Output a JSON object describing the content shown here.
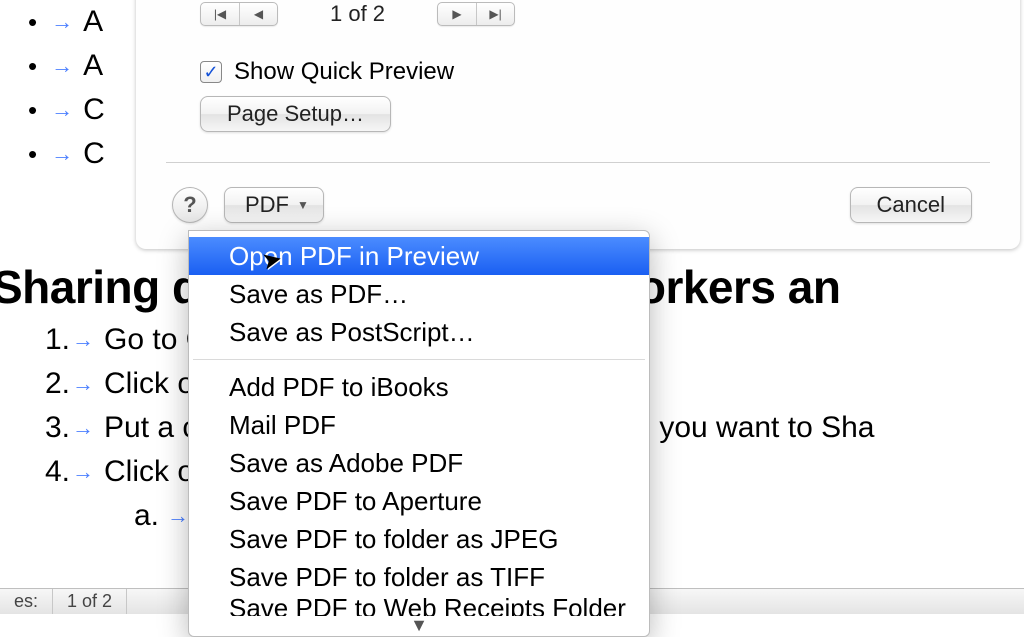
{
  "doc": {
    "bullet_items": [
      "A",
      "A",
      "C",
      "C"
    ],
    "heading": "Sharing documents with Co-workers an",
    "numbered": [
      "Go to Onedrive.live.com and sign in",
      "Click on Documents",
      "Put a check in the upper corner of the file you want to Sha",
      "Click on Share in the menu bar"
    ],
    "sub_item_letter": "a.",
    "sub_item_text": ""
  },
  "dialog": {
    "pager_label": "1 of 2",
    "show_quick_preview_label": "Show Quick Preview",
    "show_quick_preview_checked": true,
    "page_setup_label": "Page Setup…",
    "pdf_button_label": "PDF",
    "cancel_label": "Cancel",
    "help_glyph": "?"
  },
  "menu": {
    "items_group1": [
      "Open PDF in Preview",
      "Save as PDF…",
      "Save as PostScript…"
    ],
    "items_group2": [
      "Add PDF to iBooks",
      "Mail PDF",
      "Save as Adobe PDF",
      "Save PDF to Aperture",
      "Save PDF to folder as JPEG",
      "Save PDF to folder as TIFF"
    ],
    "partial_item": "Save PDF to Web Receipts Folder",
    "highlighted_index": 0
  },
  "statusbar": {
    "left_label": "es:",
    "page_label": "1 of 2"
  }
}
